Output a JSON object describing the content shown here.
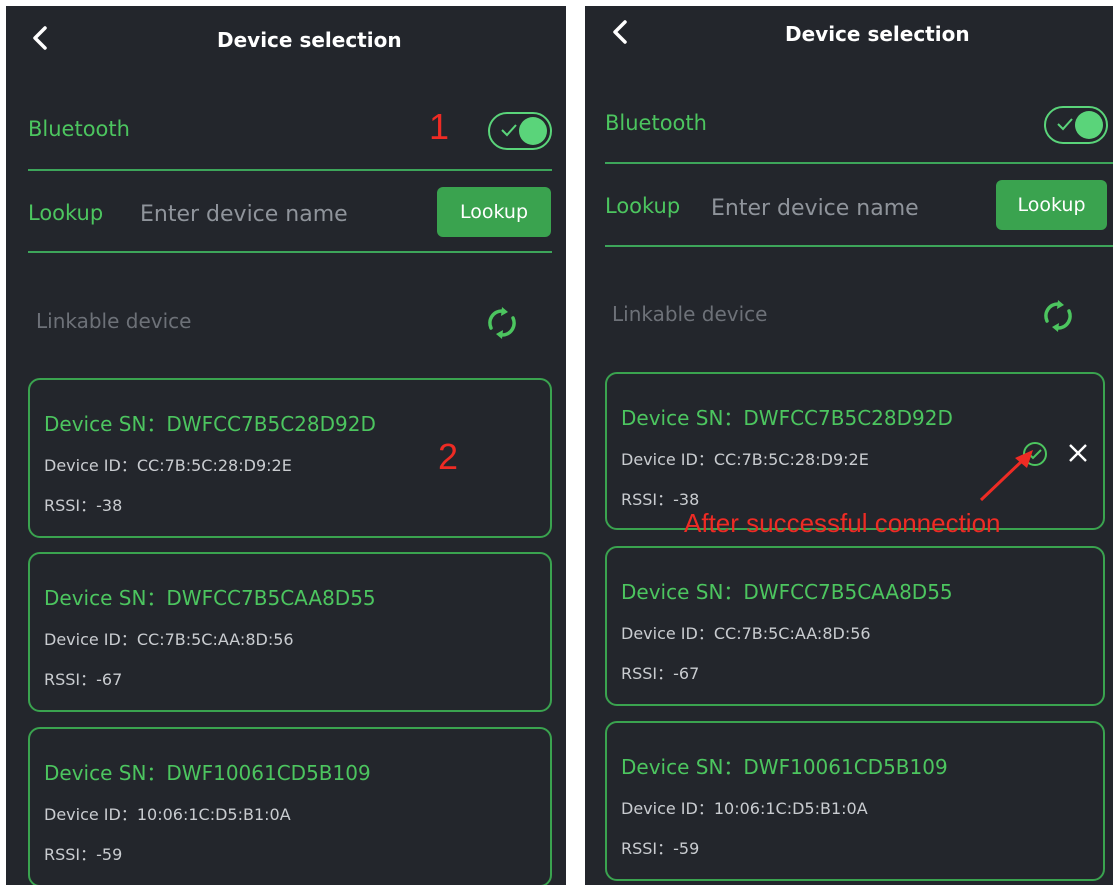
{
  "left": {
    "header": {
      "title": "Device selection"
    },
    "bluetooth": {
      "label": "Bluetooth"
    },
    "search": {
      "label": "Lookup",
      "placeholder": "Enter device name",
      "button": "Lookup"
    },
    "section": {
      "label": "Linkable device"
    },
    "devices": [
      {
        "sn": "Device SN：DWFCC7B5C28D92D",
        "id": "Device ID：CC:7B:5C:28:D9:2E",
        "rssi": "RSSI：-38"
      },
      {
        "sn": "Device SN：DWFCC7B5CAA8D55",
        "id": "Device ID：CC:7B:5C:AA:8D:56",
        "rssi": "RSSI：-67"
      },
      {
        "sn": "Device SN：DWF10061CD5B109",
        "id": "Device ID：10:06:1C:D5:B1:0A",
        "rssi": "RSSI：-59"
      }
    ],
    "annotations": {
      "step1": "1",
      "step2": "2"
    }
  },
  "right": {
    "header": {
      "title": "Device selection"
    },
    "bluetooth": {
      "label": "Bluetooth"
    },
    "search": {
      "label": "Lookup",
      "placeholder": "Enter device name",
      "button": "Lookup"
    },
    "section": {
      "label": "Linkable device"
    },
    "devices": [
      {
        "sn": "Device SN：DWFCC7B5C28D92D",
        "id": "Device ID：CC:7B:5C:28:D9:2E",
        "rssi": "RSSI：-38"
      },
      {
        "sn": "Device SN：DWFCC7B5CAA8D55",
        "id": "Device ID：CC:7B:5C:AA:8D:56",
        "rssi": "RSSI：-67"
      },
      {
        "sn": "Device SN：DWF10061CD5B109",
        "id": "Device ID：10:06:1C:D5:B1:0A",
        "rssi": "RSSI：-59"
      }
    ],
    "annotations": {
      "connected_note": "After successful connection"
    }
  },
  "colors": {
    "background": "#23262c",
    "accent_green": "#4cc55f",
    "button_green": "#3aa34f",
    "annotation_red": "#ee2b24"
  },
  "icons": {
    "back": "chevron-left-icon",
    "refresh": "refresh-icon",
    "connected": "check-circle-icon",
    "disconnect": "close-icon"
  }
}
